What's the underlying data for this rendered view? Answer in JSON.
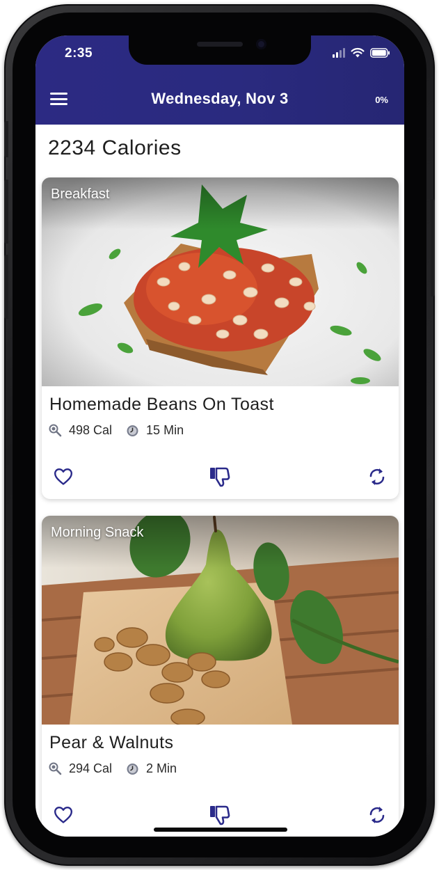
{
  "status_bar": {
    "time": "2:35"
  },
  "header": {
    "title": "Wednesday, Nov 3",
    "progress_percent": "0%",
    "menu_icon": "hamburger-icon"
  },
  "summary": {
    "calories": "2234 Calories"
  },
  "meals": [
    {
      "meal_type": "Breakfast",
      "title": "Homemade Beans On Toast",
      "calories": "498 Cal",
      "time": "15 Min",
      "image": "beans-on-toast-photo"
    },
    {
      "meal_type": "Morning Snack",
      "title": "Pear & Walnuts",
      "calories": "294 Cal",
      "time": "2 Min",
      "image": "pear-and-walnuts-photo"
    }
  ],
  "icons": {
    "favorite": "heart-icon",
    "dislike": "thumbs-down-icon",
    "swap": "refresh-icon",
    "calories": "calories-icon",
    "time": "timer-icon"
  },
  "colors": {
    "header": "#2a2a7f",
    "accent": "#2a2a8a",
    "text": "#1e1e1e",
    "meta_icon": "#7a7f8f"
  }
}
